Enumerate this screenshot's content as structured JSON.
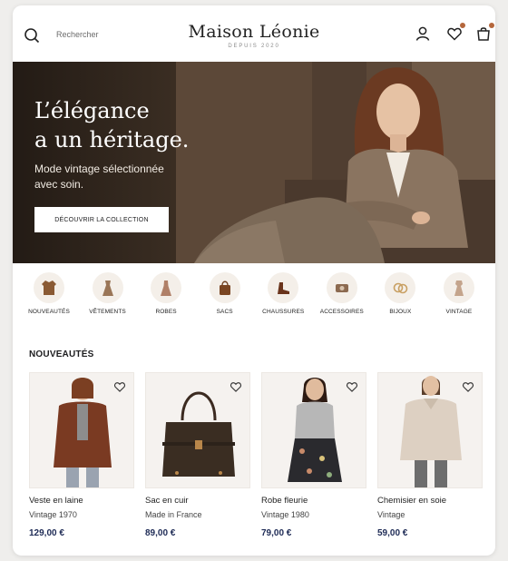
{
  "header": {
    "search_label": "Rechercher",
    "brand_name": "Maison Léonie",
    "brand_tagline": "DEPUIS 2020",
    "icons": [
      "search-icon",
      "user-icon",
      "heart-icon",
      "bag-icon"
    ],
    "accent": "#b5673c"
  },
  "hero": {
    "title_line1": "L’élégance",
    "title_line2": "a un héritage.",
    "subtitle": "Mode vintage sélectionnée avec soin.",
    "cta_label": "DÉCOUVRIR LA COLLECTION"
  },
  "categories": [
    {
      "label": "NOUVEAUTÉS",
      "icon": "coat-icon"
    },
    {
      "label": "VÊTEMENTS",
      "icon": "dress-icon"
    },
    {
      "label": "ROBES",
      "icon": "robe-icon"
    },
    {
      "label": "SACS",
      "icon": "handbag-icon"
    },
    {
      "label": "CHAUSSURES",
      "icon": "boot-icon"
    },
    {
      "label": "ACCESSOIRES",
      "icon": "accessory-icon"
    },
    {
      "label": "BIJOUX",
      "icon": "ring-icon"
    },
    {
      "label": "VINTAGE",
      "icon": "vintage-icon"
    }
  ],
  "new_section": {
    "title": "NOUVEAUTÉS",
    "products": [
      {
        "name": "Veste en laine",
        "sub": "Vintage 1970",
        "price": "129,00 €"
      },
      {
        "name": "Sac en cuir",
        "sub": "Made in France",
        "price": "89,00 €"
      },
      {
        "name": "Robe fleurie",
        "sub": "Vintage 1980",
        "price": "79,00 €"
      },
      {
        "name": "Chemisier en soie",
        "sub": "Vintage",
        "price": "59,00 €"
      }
    ]
  }
}
